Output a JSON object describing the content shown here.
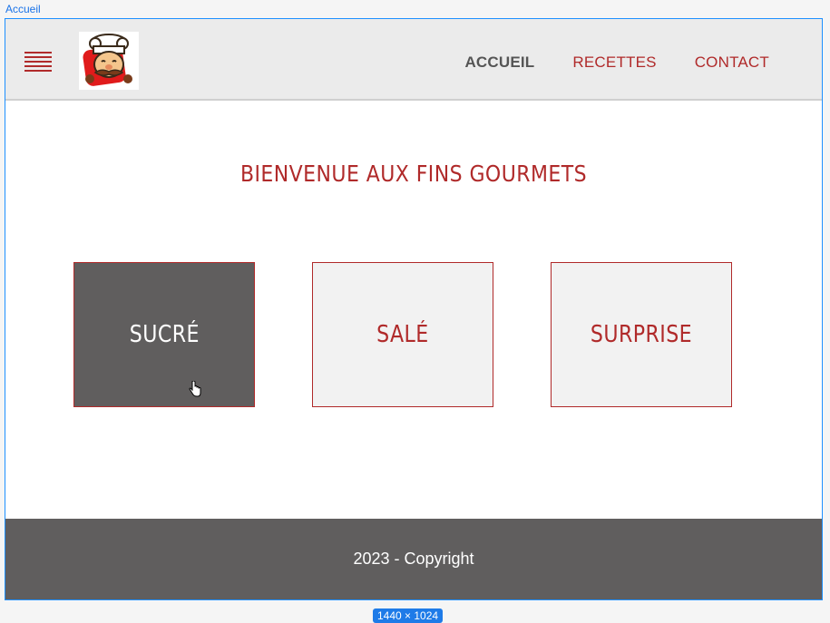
{
  "frame": {
    "label": "Accueil",
    "size_badge": "1440 × 1024"
  },
  "header": {
    "menu_icon": "hamburger-menu-icon",
    "logo_icon": "chef-mascot-logo",
    "nav": [
      {
        "label": "ACCUEIL",
        "active": true
      },
      {
        "label": "RECETTES",
        "active": false
      },
      {
        "label": "CONTACT",
        "active": false
      }
    ]
  },
  "main": {
    "title": "BIENVENUE AUX FINS GOURMETS",
    "cards": [
      {
        "label": "SUCRÉ",
        "hovered": true
      },
      {
        "label": "SALÉ",
        "hovered": false
      },
      {
        "label": "SURPRISE",
        "hovered": false
      }
    ]
  },
  "footer": {
    "text": "2023 - Copyright"
  },
  "colors": {
    "accent": "#b02a2a",
    "header_bg": "#ebebeb",
    "footer_bg": "#605e5e",
    "frame_border": "#1e90ff"
  }
}
